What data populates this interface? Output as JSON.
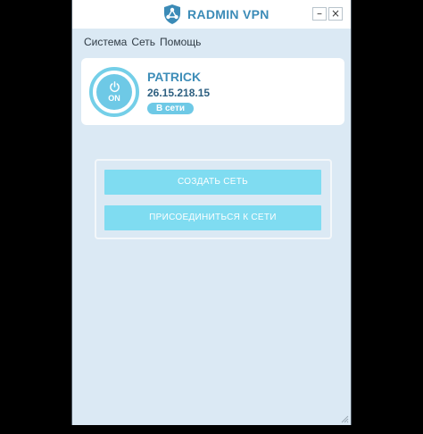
{
  "app": {
    "title": "RADMIN VPN",
    "brand_color": "#3b8bb7",
    "accent_color": "#7fdcf1"
  },
  "window_controls": {
    "minimize": "–",
    "close": "×"
  },
  "menu": {
    "items": [
      {
        "label": "Система"
      },
      {
        "label": "Сеть"
      },
      {
        "label": "Помощь"
      }
    ]
  },
  "status": {
    "power_state": "ON",
    "user_name": "PATRICK",
    "ip": "26.15.218.15",
    "online_badge": "В сети"
  },
  "actions": {
    "create_network": "СОЗДАТЬ СЕТЬ",
    "join_network": "ПРИСОЕДИНИТЬСЯ К СЕТИ"
  },
  "icons": {
    "logo": "radmin-shield-icon",
    "power": "power-icon",
    "resize": "resize-grip-icon"
  }
}
